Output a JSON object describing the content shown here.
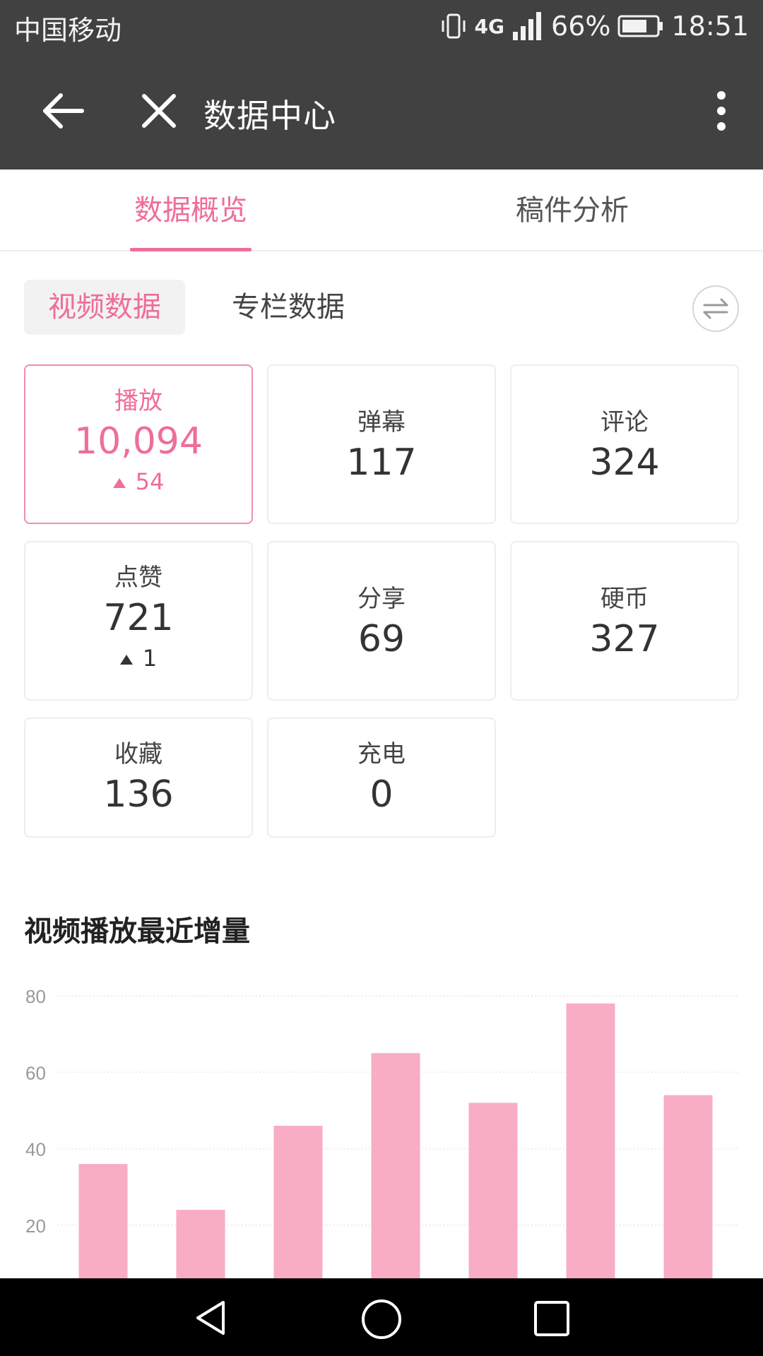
{
  "status_bar": {
    "carrier": "中国移动",
    "network": "4G",
    "battery": "66%",
    "time": "18:51"
  },
  "app_bar": {
    "title": "数据中心"
  },
  "tabs": [
    {
      "label": "数据概览",
      "active": true
    },
    {
      "label": "稿件分析",
      "active": false
    }
  ],
  "subtabs": [
    {
      "label": "视频数据",
      "active": true
    },
    {
      "label": "专栏数据",
      "active": false
    }
  ],
  "stats": [
    {
      "label": "播放",
      "value": "10,094",
      "delta": "54"
    },
    {
      "label": "弹幕",
      "value": "117"
    },
    {
      "label": "评论",
      "value": "324"
    },
    {
      "label": "点赞",
      "value": "721",
      "delta": "1"
    },
    {
      "label": "分享",
      "value": "69"
    },
    {
      "label": "硬币",
      "value": "327"
    },
    {
      "label": "收藏",
      "value": "136"
    },
    {
      "label": "充电",
      "value": "0"
    }
  ],
  "chart_title": "视频播放最近增量",
  "colors": {
    "accent": "#ee6e97",
    "bar": "#f8adc4",
    "app_bar": "#414141"
  },
  "chart_data": {
    "type": "bar",
    "title": "视频播放最近增量",
    "values": [
      36,
      24,
      46,
      65,
      52,
      78,
      54
    ],
    "yticks": [
      20,
      40,
      60,
      80
    ],
    "ylim": [
      0,
      80
    ],
    "grid": true
  }
}
